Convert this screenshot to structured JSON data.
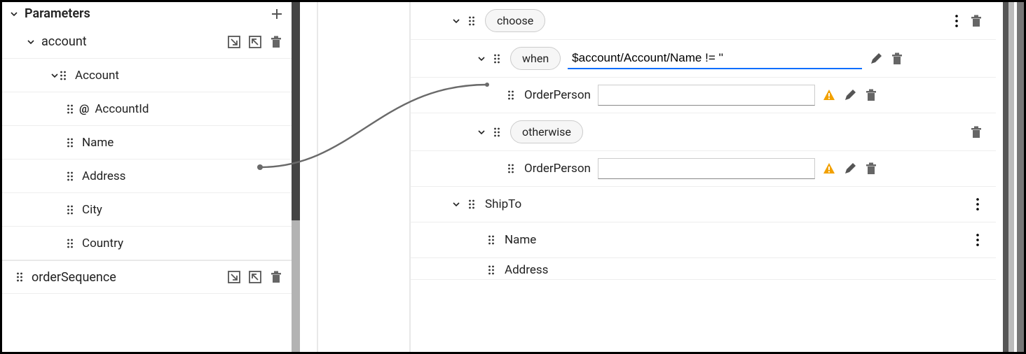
{
  "left": {
    "header": "Parameters",
    "account": {
      "label": "account",
      "children": {
        "account_node": "Account",
        "fields": [
          "AccountId",
          "Name",
          "Address",
          "City",
          "Country"
        ]
      }
    },
    "orderSequence": "orderSequence"
  },
  "right": {
    "choose": {
      "label": "choose"
    },
    "when": {
      "label": "when",
      "expr": "$account/Account/Name != ''"
    },
    "orderPerson1": {
      "label": "OrderPerson",
      "value": ""
    },
    "otherwise": {
      "label": "otherwise"
    },
    "orderPerson2": {
      "label": "OrderPerson",
      "value": ""
    },
    "shipTo": {
      "label": "ShipTo"
    },
    "shipToName": {
      "label": "Name"
    },
    "shipToAddress": {
      "label": "Address"
    }
  }
}
